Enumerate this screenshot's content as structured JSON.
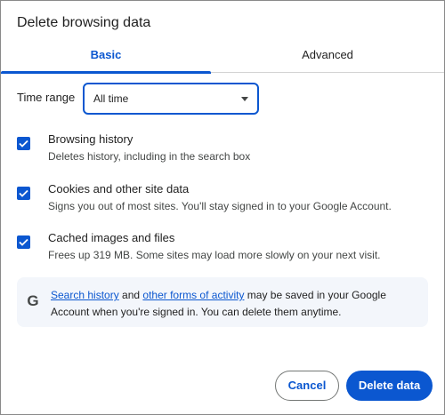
{
  "dialog": {
    "title": "Delete browsing data"
  },
  "tabs": [
    {
      "label": "Basic",
      "selected": true
    },
    {
      "label": "Advanced",
      "selected": false
    }
  ],
  "time_range": {
    "label": "Time range",
    "value": "All time"
  },
  "options": [
    {
      "title": "Browsing history",
      "description": "Deletes history, including in the search box",
      "checked": true
    },
    {
      "title": "Cookies and other site data",
      "description": "Signs you out of most sites. You'll stay signed in to your Google Account.",
      "checked": true
    },
    {
      "title": "Cached images and files",
      "description": "Frees up 319 MB. Some sites may load more slowly on your next visit.",
      "checked": true
    }
  ],
  "info": {
    "icon": "google-g-icon",
    "link1": "Search history",
    "text1": " and ",
    "link2": "other forms of activity",
    "text2": " may be saved in your Google Account when you're signed in. You can delete them anytime."
  },
  "buttons": {
    "cancel": "Cancel",
    "delete": "Delete data"
  },
  "colors": {
    "accent": "#0b57d0",
    "info_bg": "#f3f6fb"
  }
}
